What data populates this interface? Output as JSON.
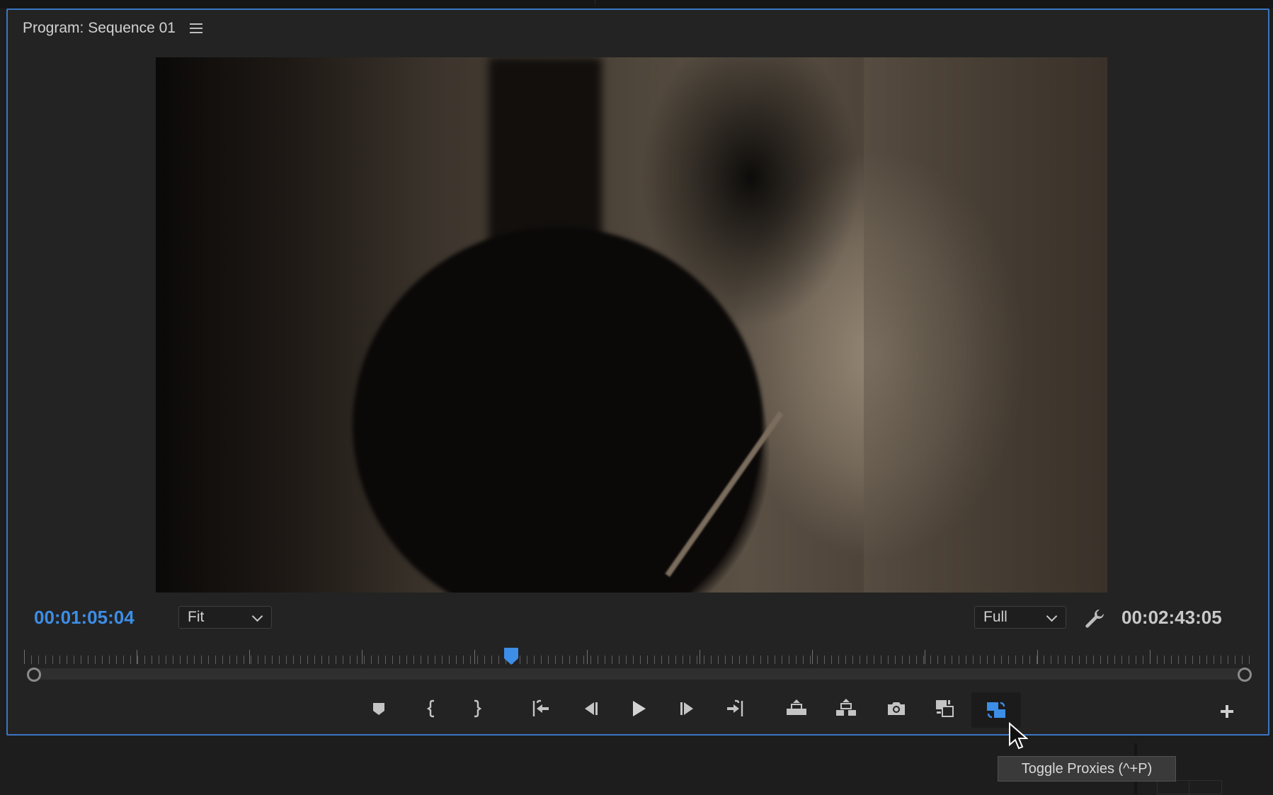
{
  "panel": {
    "title": "Program: Sequence 01",
    "menu_icon": "hamburger-menu-icon"
  },
  "viewer": {
    "current_timecode": "00:01:05:04",
    "duration_timecode": "00:02:43:05",
    "zoom": {
      "selected": "Fit"
    },
    "resolution": {
      "selected": "Full"
    },
    "playhead_position": 0.397
  },
  "transport": {
    "buttons": [
      {
        "name": "add-marker-button",
        "icon": "marker-icon"
      },
      {
        "name": "mark-in-button",
        "icon": "mark-in-icon"
      },
      {
        "name": "mark-out-button",
        "icon": "mark-out-icon"
      },
      {
        "name": "go-to-in-button",
        "icon": "go-to-in-icon"
      },
      {
        "name": "step-back-button",
        "icon": "step-back-icon"
      },
      {
        "name": "play-button",
        "icon": "play-icon"
      },
      {
        "name": "step-forward-button",
        "icon": "step-forward-icon"
      },
      {
        "name": "go-to-out-button",
        "icon": "go-to-out-icon"
      },
      {
        "name": "lift-button",
        "icon": "lift-icon"
      },
      {
        "name": "extract-button",
        "icon": "extract-icon"
      },
      {
        "name": "export-frame-button",
        "icon": "camera-icon"
      },
      {
        "name": "comparison-view-button",
        "icon": "comparison-view-icon"
      },
      {
        "name": "toggle-proxies-button",
        "icon": "toggle-proxies-icon",
        "active": true
      }
    ],
    "add_button_icon": "plus-icon"
  },
  "tooltip": {
    "text": "Toggle Proxies (^+P)"
  },
  "colors": {
    "accent": "#3d8ee6",
    "panel_border": "#3a76c4",
    "panel_bg": "#232323"
  }
}
